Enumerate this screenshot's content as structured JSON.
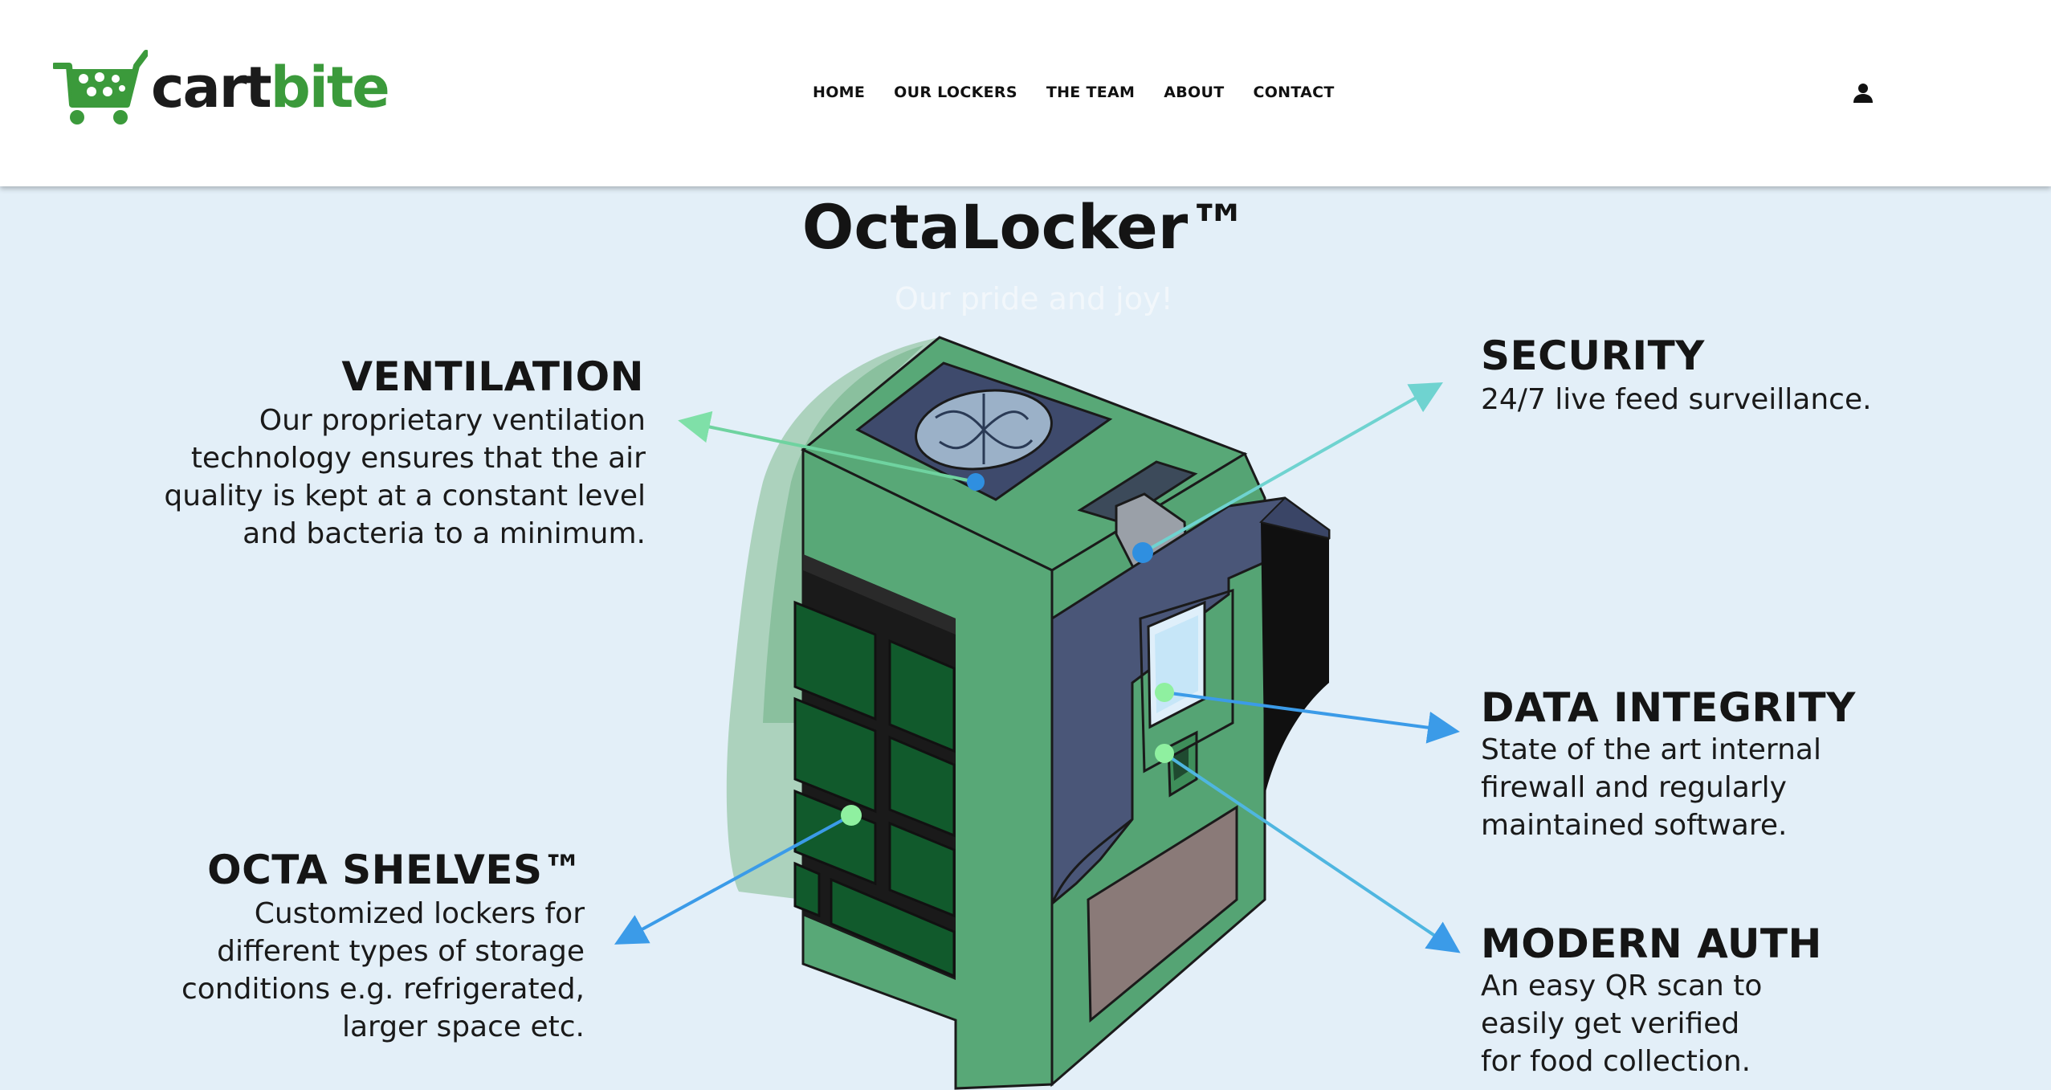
{
  "brand": {
    "name_part1": "cart",
    "name_part2": "bite"
  },
  "nav": {
    "items": [
      {
        "label": "HOME"
      },
      {
        "label": "OUR LOCKERS"
      },
      {
        "label": "THE TEAM"
      },
      {
        "label": "ABOUT"
      },
      {
        "label": "CONTACT"
      }
    ]
  },
  "hero": {
    "title": "OctaLocker™",
    "subtitle": "Our pride and joy!"
  },
  "features": {
    "ventilation": {
      "heading": "VENTILATION",
      "lines": [
        "Our proprietary ventilation",
        "technology ensures that the air",
        "quality is kept at a constant level",
        "and bacteria to a minimum."
      ]
    },
    "security": {
      "heading": "SECURITY",
      "lines": [
        "24/7 live feed surveillance."
      ]
    },
    "data_integrity": {
      "heading": "DATA INTEGRITY",
      "lines": [
        "State of the art internal",
        "firewall and regularly",
        "maintained software."
      ]
    },
    "octa_shelves": {
      "heading": "OCTA SHELVES™",
      "lines": [
        "Customized lockers for",
        "different types of storage",
        "conditions e.g. refrigerated,",
        "larger space etc."
      ]
    },
    "modern_auth": {
      "heading": "MODERN AUTH",
      "lines": [
        "An easy QR scan to",
        "easily get verified",
        "for food collection."
      ]
    }
  },
  "colors": {
    "background": "#e3eff8",
    "brand_green": "#3b9a3b",
    "locker_green": "#58a877",
    "panel_blue": "#4a5678",
    "shelf_green": "#115a2c"
  }
}
